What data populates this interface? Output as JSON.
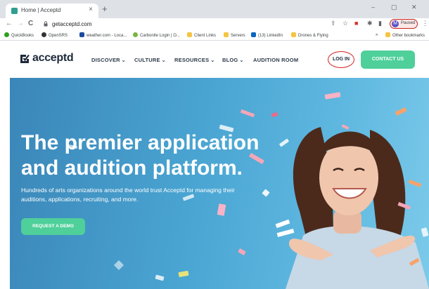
{
  "browser": {
    "tab_title": "Home | Acceptd",
    "tab_close": "×",
    "new_tab": "+",
    "url": "getacceptd.com",
    "profile_status": "Paused",
    "profile_initial": "M",
    "window_minimize": "‒",
    "window_restore": "▢",
    "window_close": "✕",
    "nav_back": "←",
    "nav_forward": "→",
    "nav_reload": "C",
    "bookmarks": [
      {
        "label": "QuickBooks",
        "color": "#2ca01c"
      },
      {
        "label": "OpenSRS",
        "color": "#333333"
      },
      {
        "label": "weather.com - Loca...",
        "color": "#1b4b9b"
      },
      {
        "label": "Carbonite Login | O...",
        "color": "#7bb342"
      },
      {
        "label": "Client Links",
        "color": "#f4c542"
      },
      {
        "label": "Servers",
        "color": "#f4c542"
      },
      {
        "label": "(13) LinkedIn",
        "color": "#0a66c2"
      },
      {
        "label": "Drones & Flying",
        "color": "#f4c542"
      }
    ],
    "bookmarks_overflow": "»",
    "other_bookmarks": "Other bookmarks"
  },
  "site": {
    "logo_text": "acceptd",
    "nav": [
      {
        "label": "DISCOVER",
        "chevron": "⌄"
      },
      {
        "label": "CULTURE",
        "chevron": "⌄"
      },
      {
        "label": "RESOURCES",
        "chevron": "⌄"
      },
      {
        "label": "BLOG",
        "chevron": "⌄"
      },
      {
        "label": "AUDITION ROOM",
        "chevron": ""
      }
    ],
    "login_label": "LOG IN",
    "contact_label": "CONTACT US"
  },
  "hero": {
    "headline": "The premier application and audition platform.",
    "subtext": "Hundreds of arts organizations around the world trust Acceptd for managing their auditions, applications, recruiting, and more.",
    "cta_label": "REQUEST A DEMO"
  },
  "colors": {
    "accent_green": "#4fcf9a",
    "hero_blue": "#4aa5d2",
    "login_circle": "#d3231f"
  }
}
